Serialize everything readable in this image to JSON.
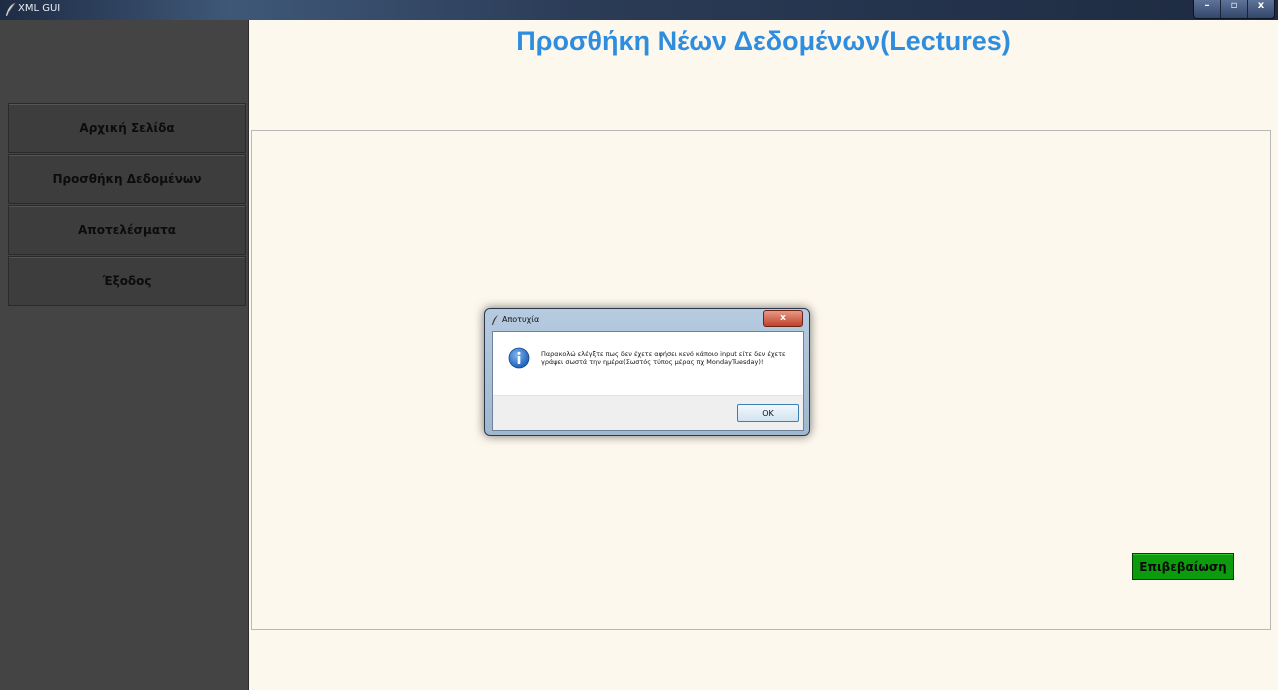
{
  "window": {
    "title": "XML GUI",
    "minimize_label": "–",
    "maximize_label": "▫",
    "close_label": "x"
  },
  "sidebar": {
    "items": [
      {
        "label": "Αρχική Σελίδα"
      },
      {
        "label": "Προσθήκη Δεδομένων"
      },
      {
        "label": "Αποτελέσματα"
      },
      {
        "label": "Έξοδος"
      }
    ]
  },
  "main": {
    "title": "Προσθήκη Νέων Δεδομένων(Lectures)",
    "confirm_label": "Επιβεβαίωση"
  },
  "dialog": {
    "title": "Αποτυχία",
    "close_label": "x",
    "message": "Παρακολώ ελέγξτε πως δεν έχετε αφήσει κενό κάποιο input είτε δεν έχετε γράψει σωστά την ημέρα(Σωστός τύπος μέρας πχ MondayTuesday)!",
    "ok_label": "OK"
  },
  "colors": {
    "title_blue": "#2f8de0",
    "sidebar_bg": "#444444",
    "content_bg": "#fdf8ee",
    "confirm_green": "#0c9b0c"
  }
}
